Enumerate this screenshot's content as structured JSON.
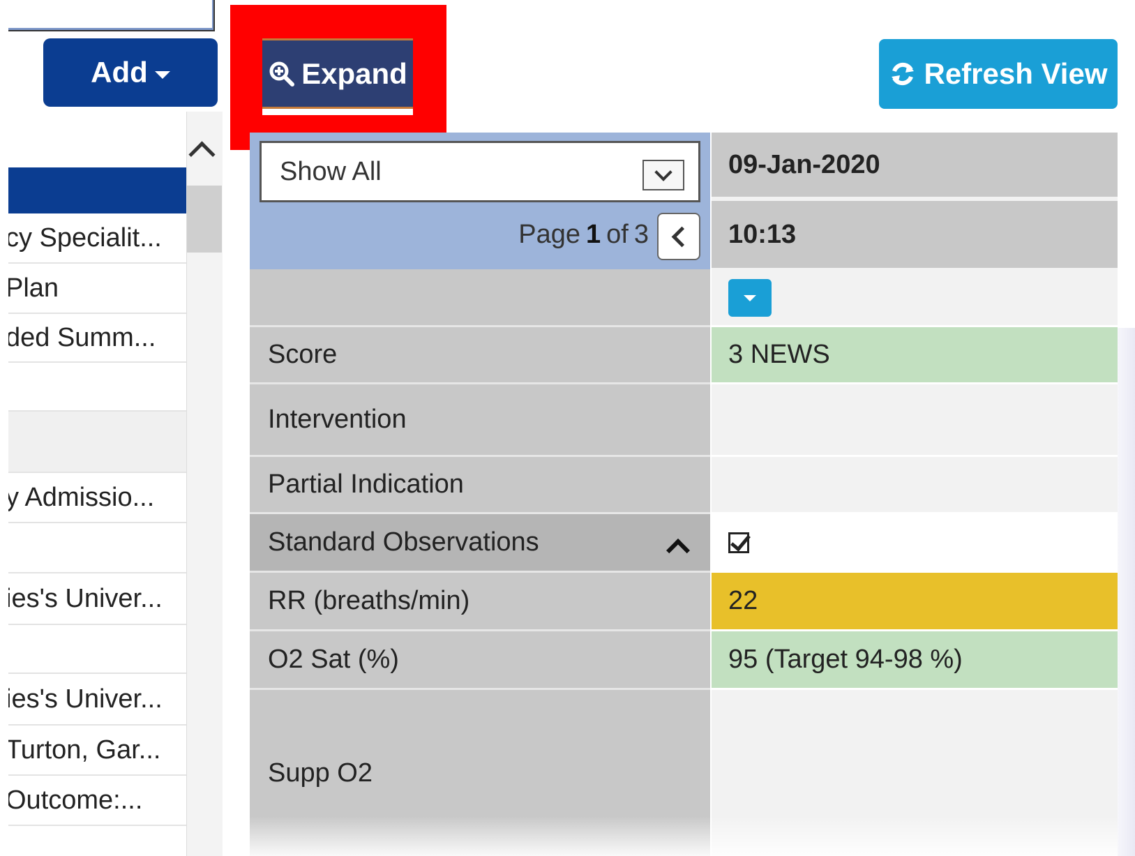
{
  "toolbar": {
    "add_label": "Add",
    "expand_label": "Expand",
    "refresh_label": "Refresh View"
  },
  "left_list": {
    "items": [
      {
        "label": "",
        "selected": true
      },
      {
        "label": "cy Specialit...",
        "selected": false
      },
      {
        "label": "Plan",
        "selected": false
      },
      {
        "label": "ded Summ...",
        "selected": false
      },
      {
        "label": "",
        "selected": false
      },
      {
        "label": "",
        "selected": false
      },
      {
        "label": "y Admissio...",
        "selected": false
      },
      {
        "label": "",
        "selected": false
      },
      {
        "label": "ies's Univer...",
        "selected": false
      },
      {
        "label": "",
        "selected": false
      },
      {
        "label": "ies's Univer...",
        "selected": false
      },
      {
        "label": "Turton, Gar...",
        "selected": false
      },
      {
        "label": "Outcome:...",
        "selected": false
      }
    ]
  },
  "grid": {
    "filter": {
      "selected": "Show All"
    },
    "pager": {
      "prefix": "Page",
      "current": "1",
      "middle": "of",
      "total": "3"
    },
    "column": {
      "date": "09-Jan-2020",
      "time": "10:13"
    },
    "rows": {
      "score": {
        "label": "Score",
        "value": "3 NEWS"
      },
      "intervention": {
        "label": "Intervention",
        "value": ""
      },
      "partial": {
        "label": "Partial Indication",
        "value": ""
      },
      "standard": {
        "label": "Standard Observations",
        "checked": true
      },
      "rr": {
        "label": "RR (breaths/min)",
        "value": "22"
      },
      "o2sat": {
        "label": "O2 Sat (%)",
        "value": "95 (Target 94-98 %)"
      },
      "suppo2": {
        "label": "Supp O2",
        "value": ""
      }
    }
  },
  "colors": {
    "add_button": "#0b3d91",
    "expand_button": "#2d3f73",
    "refresh_button": "#1a9fd6",
    "highlight_box": "#ff0000",
    "normal_value": "#c2e0c0",
    "warning_value": "#e8c02a"
  },
  "icons": {
    "add": "caret-down-icon",
    "expand": "zoom-in-icon",
    "refresh": "refresh-icon",
    "filter": "chevron-down-icon",
    "pager_prev": "chevron-left-icon",
    "column_menu": "caret-down-icon",
    "group_toggle": "chevron-up-icon",
    "group_check": "checkbox-checked-icon"
  }
}
